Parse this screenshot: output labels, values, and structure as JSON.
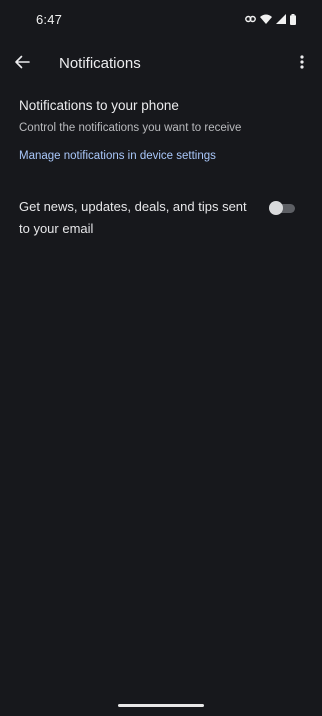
{
  "status_bar": {
    "time": "6:47",
    "icons": [
      "link-icon",
      "wifi-icon",
      "signal-icon",
      "battery-icon"
    ]
  },
  "app_bar": {
    "back_icon": "arrow-back-icon",
    "title": "Notifications",
    "more_icon": "more-vert-icon"
  },
  "phone_notifications": {
    "title": "Notifications to your phone",
    "description": "Control the notifications you want to receive",
    "link_label": "Manage notifications in device settings"
  },
  "email_option": {
    "label": "Get news, updates, deals, and tips sent to your email",
    "enabled": false
  },
  "colors": {
    "background": "#17181c",
    "link": "#a9c7fa",
    "toggle_track_off": "#5d5f64",
    "toggle_thumb_off": "#d9dadc"
  }
}
